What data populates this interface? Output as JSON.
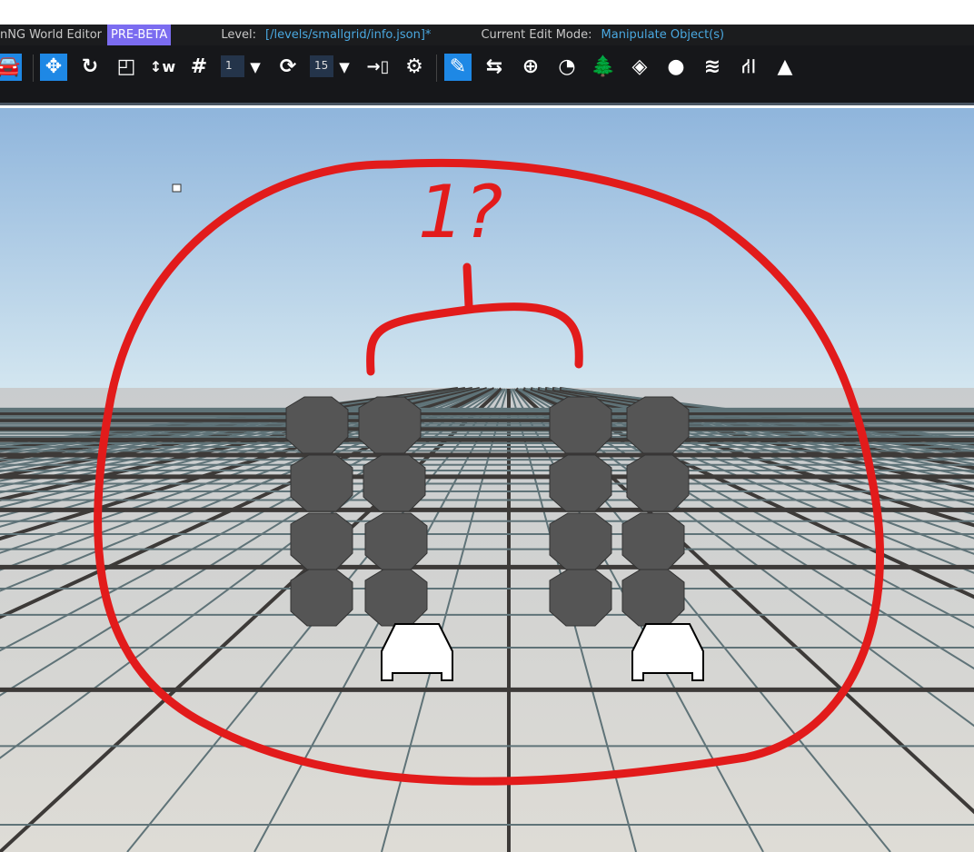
{
  "title": {
    "app": "nNG World Editor",
    "badge": "PRE-BETA",
    "level_label": "Level:",
    "level_value": "[/levels/smallgrid/info.json]*",
    "mode_label": "Current Edit Mode:",
    "mode_value": "Manipulate Object(s)"
  },
  "toolbar": {
    "grid_size": "1",
    "rotation_snap": "15",
    "icons": [
      "car-icon",
      "translate-icon",
      "rotate-icon",
      "scale-icon",
      "world-axis-icon",
      "grid-snap-icon",
      "dropdown-icon",
      "rotate-snap-icon",
      "dropdown-icon",
      "ruler-icon",
      "settings-icon",
      "pencil-icon",
      "camera-path-icon",
      "add-icon",
      "decal-icon",
      "forest-icon",
      "mesh-road-icon",
      "object-placer-icon",
      "river-icon",
      "road-icon",
      "terrain-icon"
    ]
  },
  "annotation": {
    "text": "1?"
  },
  "colors": {
    "accent": "#1e88e5",
    "badge": "#7b6cf0",
    "annotation": "#e21b1b"
  }
}
